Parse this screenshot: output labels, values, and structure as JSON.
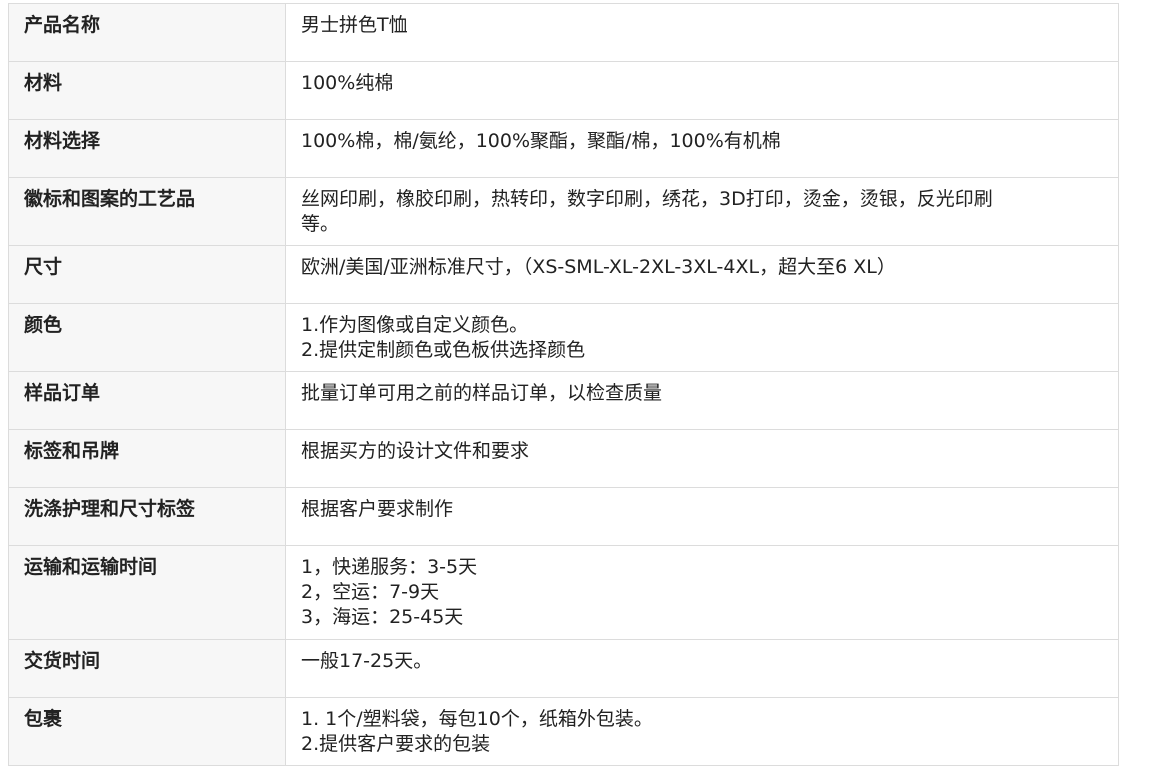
{
  "table": {
    "rows": [
      {
        "label": "产品名称",
        "lines": [
          "男士拼色T恤"
        ]
      },
      {
        "label": "材料",
        "lines": [
          "100%纯棉"
        ]
      },
      {
        "label": "材料选择",
        "lines": [
          "100%棉，棉/氨纶，100%聚酯，聚酯/棉，100%有机棉"
        ]
      },
      {
        "label": "徽标和图案的工艺品",
        "lines": [
          "丝网印刷，橡胶印刷，热转印，数字印刷，绣花，3D打印，烫金，烫银，反光印刷",
          "等。"
        ]
      },
      {
        "label": "尺寸",
        "lines": [
          "欧洲/美国/亚洲标准尺寸，（XS-SML-XL-2XL-3XL-4XL，超大至6 XL）"
        ]
      },
      {
        "label": "颜色",
        "lines": [
          "1.作为图像或自定义颜色。",
          "2.提供定制颜色或色板供选择颜色"
        ]
      },
      {
        "label": "样品订单",
        "lines": [
          "批量订单可用之前的样品订单，以检查质量"
        ]
      },
      {
        "label": "标签和吊牌",
        "lines": [
          "根据买方的设计文件和要求"
        ]
      },
      {
        "label": "洗涤护理和尺寸标签",
        "lines": [
          "根据客户要求制作"
        ]
      },
      {
        "label": "运输和运输时间",
        "lines": [
          "1，快递服务：3-5天",
          "2，空运：7-9天",
          "3，海运：25-45天"
        ]
      },
      {
        "label": "交货时间",
        "lines": [
          "一般17-25天。"
        ]
      },
      {
        "label": "包裹",
        "lines": [
          "1. 1个/塑料袋，每包10个，纸箱外包装。",
          "2.提供客户要求的包装"
        ]
      }
    ]
  }
}
